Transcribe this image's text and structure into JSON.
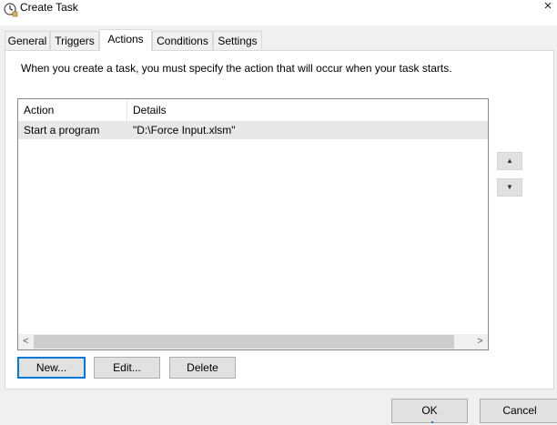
{
  "window": {
    "title": "Create Task",
    "close_glyph": "×"
  },
  "tabs": [
    {
      "label": "General",
      "active": false
    },
    {
      "label": "Triggers",
      "active": false
    },
    {
      "label": "Actions",
      "active": true
    },
    {
      "label": "Conditions",
      "active": false
    },
    {
      "label": "Settings",
      "active": false
    }
  ],
  "actions_tab": {
    "description": "When you create a task, you must specify the action that will occur when your task starts.",
    "columns": [
      "Action",
      "Details"
    ],
    "rows": [
      {
        "action": "Start a program",
        "details": "\"D:\\Force Input.xlsm\""
      }
    ],
    "scroll_left_glyph": "<",
    "scroll_right_glyph": ">",
    "move_up_glyph": "▲",
    "move_down_glyph": "▼",
    "buttons": {
      "new": "New...",
      "edit": "Edit...",
      "delete": "Delete"
    }
  },
  "dialog_buttons": {
    "ok": "OK",
    "cancel": "Cancel"
  },
  "colors": {
    "accent": "#0078d7",
    "selected_row": "#e8e8e8"
  },
  "icons": {
    "title": "clock-icon",
    "close": "close-icon",
    "scroll_left": "arrow-left-icon",
    "scroll_right": "arrow-right-icon",
    "move_up": "arrow-up-icon",
    "move_down": "arrow-down-icon"
  }
}
